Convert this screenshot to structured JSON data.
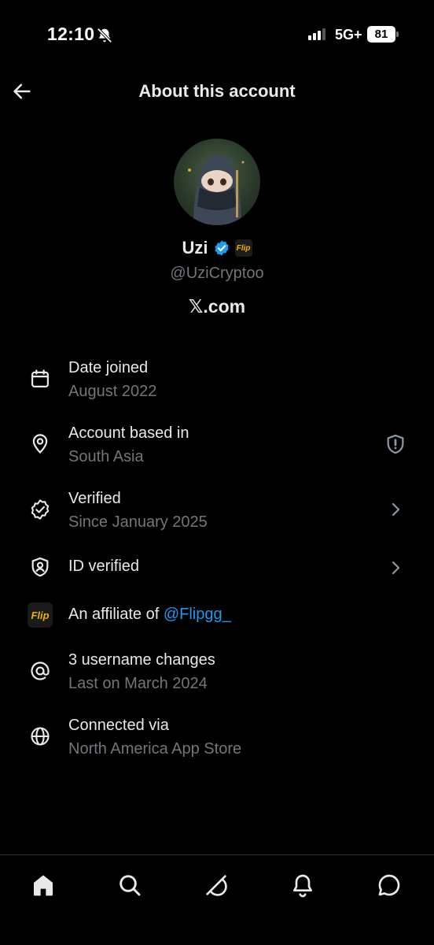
{
  "status_bar": {
    "time": "12:10",
    "network": "5G+",
    "battery": "81"
  },
  "header": {
    "title": "About this account"
  },
  "profile": {
    "name": "Uzi",
    "handle": "@UziCryptoo",
    "platform": "𝕏.com",
    "affiliate_badge_text": "Flip"
  },
  "info": {
    "date_joined": {
      "title": "Date joined",
      "sub": "August 2022",
      "icon": "calendar-icon"
    },
    "based_in": {
      "title": "Account based in",
      "sub": "South Asia",
      "icon": "location-pin-icon"
    },
    "verified": {
      "title": "Verified",
      "sub": "Since January 2025",
      "icon": "verified-badge-outline-icon"
    },
    "id_verified": {
      "title": "ID verified",
      "icon": "id-shield-icon"
    },
    "affiliate": {
      "title": "An affiliate of ",
      "link": "@Flipgg_",
      "icon_text": "Flip"
    },
    "username_changes": {
      "title": "3 username changes",
      "sub": "Last on March 2024",
      "icon": "at-icon"
    },
    "connected_via": {
      "title": "Connected via",
      "sub": "North America App Store",
      "icon": "globe-icon"
    }
  },
  "nav": [
    "home-icon",
    "search-icon",
    "grok-icon",
    "notifications-icon",
    "messages-icon"
  ],
  "colors": {
    "accent": "#1d9bf0",
    "background": "#000000",
    "muted": "#71767b",
    "text": "#e7e9ea"
  }
}
